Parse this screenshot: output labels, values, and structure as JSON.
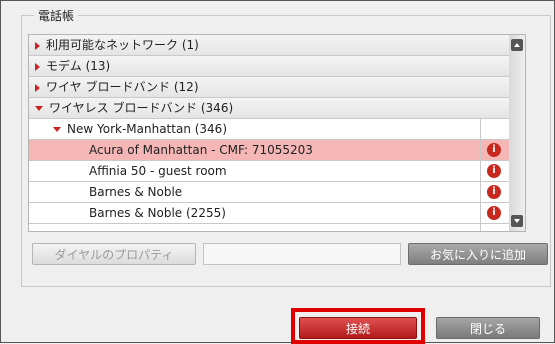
{
  "phonebook": {
    "title": "電話帳",
    "categories": [
      {
        "label": "利用可能なネットワーク (1)"
      },
      {
        "label": "モデム (13)"
      },
      {
        "label": "ワイヤ ブロードバンド (12)"
      },
      {
        "label": "ワイヤレス ブロードバンド (346)"
      }
    ],
    "region": {
      "label": "New York-Manhattan (346)"
    },
    "entries": [
      {
        "label": "Acura of Manhattan - CMF: 71055203",
        "selected": true
      },
      {
        "label": "Affinia 50 - guest room",
        "selected": false
      },
      {
        "label": "Barnes & Noble",
        "selected": false
      },
      {
        "label": "Barnes & Noble (2255)",
        "selected": false
      }
    ],
    "info_glyph": "i"
  },
  "buttons": {
    "dial_properties": "ダイヤルのプロパティ",
    "add_favorite": "お気に入りに追加",
    "connect": "接続",
    "close": "閉じる"
  },
  "colors": {
    "selected_row": "#f5b6b6",
    "accent_red": "#c22222",
    "highlight_box": "#e00000"
  }
}
